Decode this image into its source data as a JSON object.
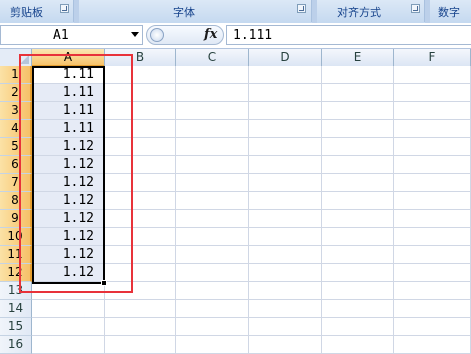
{
  "ribbon": {
    "groups": [
      {
        "label": "剪贴板"
      },
      {
        "label": "字体"
      },
      {
        "label": "对齐方式"
      },
      {
        "label": "数字"
      }
    ]
  },
  "formula_bar": {
    "name_box": "A1",
    "fx_label": "fx",
    "formula": "1.111"
  },
  "sheet": {
    "columns": [
      "A",
      "B",
      "C",
      "D",
      "E",
      "F"
    ],
    "rows": [
      "1",
      "2",
      "3",
      "4",
      "5",
      "6",
      "7",
      "8",
      "9",
      "10",
      "11",
      "12",
      "13",
      "14",
      "15",
      "16"
    ],
    "column_a_values": [
      "1.11",
      "1.11",
      "1.11",
      "1.11",
      "1.12",
      "1.12",
      "1.12",
      "1.12",
      "1.12",
      "1.12",
      "1.12",
      "1.12"
    ],
    "selected_range": "A1:A12",
    "selection_highlight": "#e6ebf6",
    "annotation_color": "#e8323a"
  }
}
